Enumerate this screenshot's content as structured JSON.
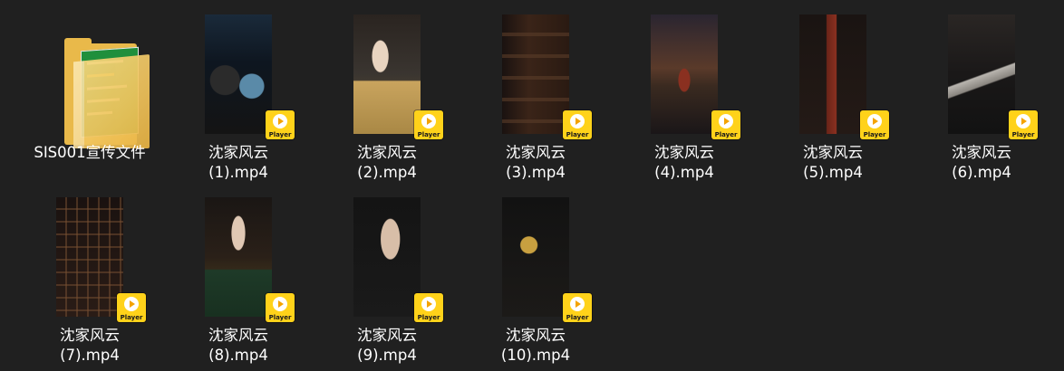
{
  "folder": {
    "name": "SIS001宣传文件",
    "icon": "folder-icon"
  },
  "badge": {
    "label": "Player",
    "color": "#ffd21a"
  },
  "files": [
    {
      "name_line1": "沈家风云",
      "name_line2": "(1).mp4"
    },
    {
      "name_line1": "沈家风云",
      "name_line2": "(2).mp4"
    },
    {
      "name_line1": "沈家风云",
      "name_line2": "(3).mp4"
    },
    {
      "name_line1": "沈家风云",
      "name_line2": "(4).mp4"
    },
    {
      "name_line1": "沈家风云",
      "name_line2": "(5).mp4"
    },
    {
      "name_line1": "沈家风云",
      "name_line2": "(6).mp4"
    },
    {
      "name_line1": "沈家风云",
      "name_line2": "(7).mp4"
    },
    {
      "name_line1": "沈家风云",
      "name_line2": "(8).mp4"
    },
    {
      "name_line1": "沈家风云",
      "name_line2": "(9).mp4"
    },
    {
      "name_line1": "沈家风云",
      "name_line2": "(10).mp4"
    }
  ],
  "colors": {
    "background": "#202020",
    "text": "#ffffff"
  }
}
